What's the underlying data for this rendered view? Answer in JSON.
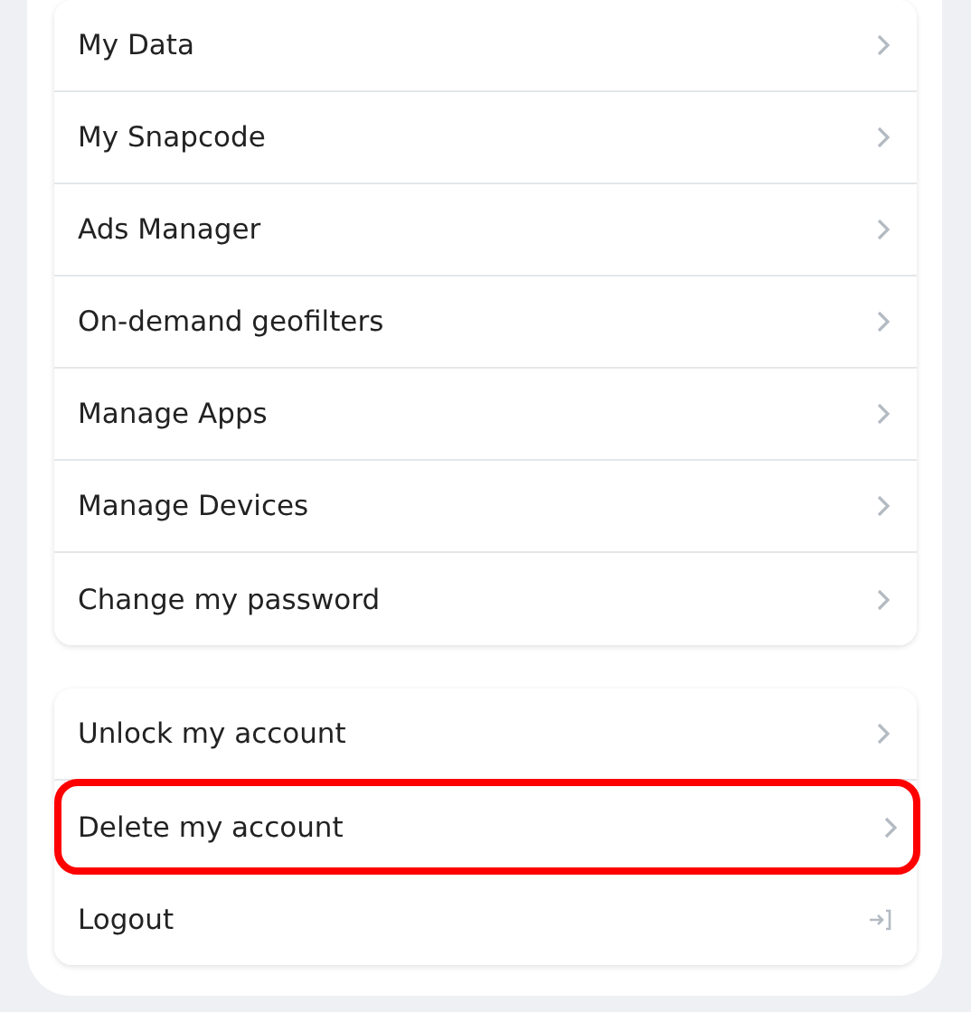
{
  "sections": [
    {
      "items": [
        {
          "label": "My Data",
          "kind": "chevron",
          "highlighted": false
        },
        {
          "label": "My Snapcode",
          "kind": "chevron",
          "highlighted": false
        },
        {
          "label": "Ads Manager",
          "kind": "chevron",
          "highlighted": false
        },
        {
          "label": "On-demand geofilters",
          "kind": "chevron",
          "highlighted": false
        },
        {
          "label": "Manage Apps",
          "kind": "chevron",
          "highlighted": false
        },
        {
          "label": "Manage Devices",
          "kind": "chevron",
          "highlighted": false
        },
        {
          "label": "Change my password",
          "kind": "chevron",
          "highlighted": false
        }
      ]
    },
    {
      "items": [
        {
          "label": "Unlock my account",
          "kind": "chevron",
          "highlighted": false
        },
        {
          "label": "Delete my account",
          "kind": "chevron",
          "highlighted": true
        },
        {
          "label": "Logout",
          "kind": "logout",
          "highlighted": false
        }
      ]
    }
  ]
}
